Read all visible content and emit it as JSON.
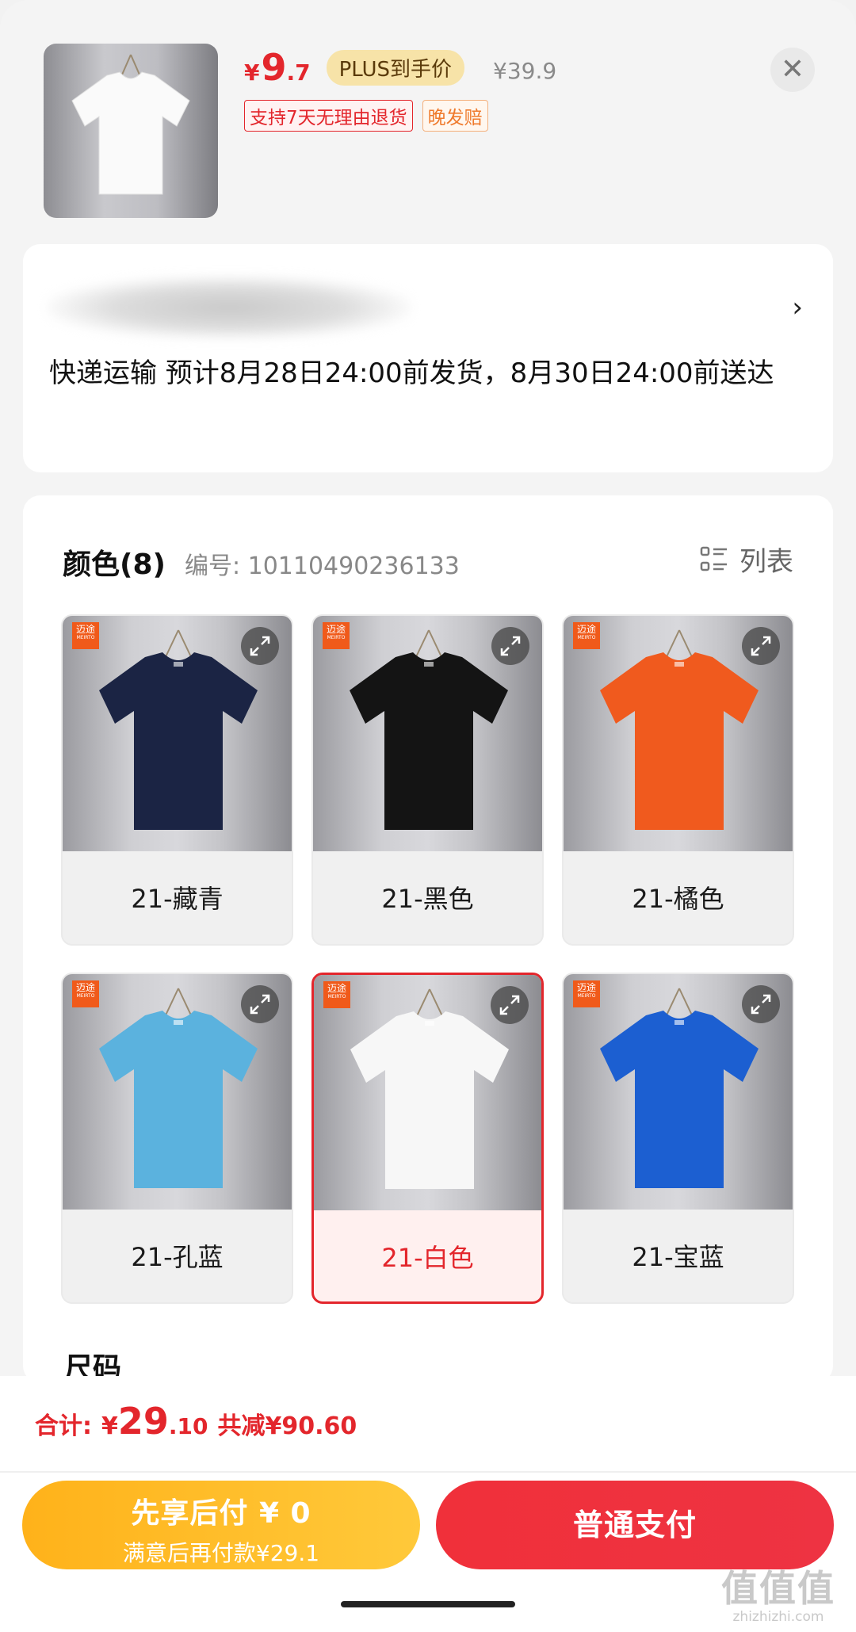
{
  "header": {
    "price": {
      "currency": "¥",
      "integer": "9",
      "decimal": ".7"
    },
    "plus_label": "PLUS到手价",
    "original_price": "¥39.9",
    "tags": [
      "支持7天无理由退货",
      "晚发赔"
    ],
    "close_icon": "close-icon",
    "product_color": "#ffffff"
  },
  "address": {
    "arrow": "›",
    "delivery_text": "快递运输 预计8月28日24:00前发货，8月30日24:00前送达"
  },
  "spec": {
    "title": "颜色(8)",
    "code": "编号: 10110490236133",
    "list_toggle_label": "列表",
    "brand_mark": "迈途",
    "brand_sub": "MEIRTO",
    "colors": [
      {
        "label": "21-藏青",
        "shirt": "#1b2444",
        "selected": false
      },
      {
        "label": "21-黑色",
        "shirt": "#141414",
        "selected": false
      },
      {
        "label": "21-橘色",
        "shirt": "#f05a1e",
        "selected": false
      },
      {
        "label": "21-孔蓝",
        "shirt": "#5bb2de",
        "selected": false
      },
      {
        "label": "21-白色",
        "shirt": "#f7f7f7",
        "selected": true
      },
      {
        "label": "21-宝蓝",
        "shirt": "#1c5fd1",
        "selected": false
      }
    ],
    "size_title": "尺码"
  },
  "footer": {
    "total_label": "合计:",
    "total_currency": "¥",
    "total_integer": "29",
    "total_decimal": ".10",
    "saved_text": "共减¥90.60",
    "pay_later_main": "先享后付 ¥ 0",
    "pay_later_sub": "满意后再付款¥29.1",
    "pay_normal": "普通支付"
  },
  "watermark": {
    "logo": "值值值",
    "url": "zhizhizhi.com"
  },
  "colors": {
    "accent_red": "#e3262c",
    "accent_yellow": "#ffb21a",
    "plus_gold": "#f7e3a8"
  }
}
